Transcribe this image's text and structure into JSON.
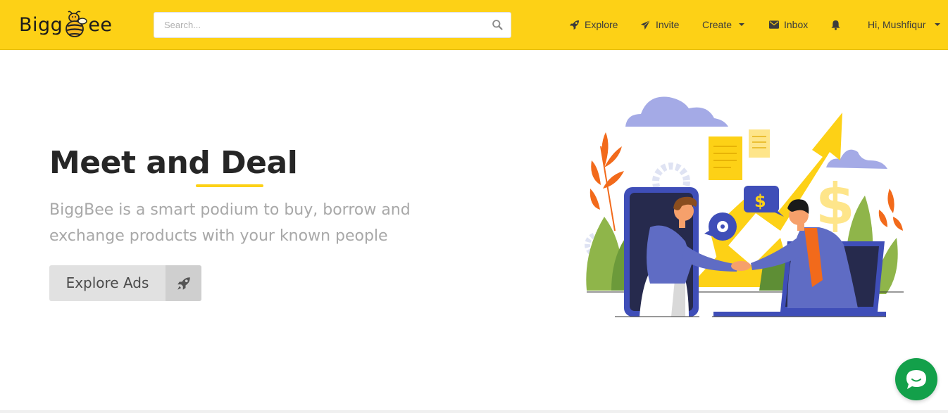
{
  "header": {
    "logo": {
      "text_left": "Bigg",
      "text_right": "ee",
      "icon": "bee-icon"
    },
    "search": {
      "placeholder": "Search...",
      "value": "",
      "icon": "search-icon"
    },
    "nav": [
      {
        "label": "Explore",
        "icon": "rocket-icon"
      },
      {
        "label": "Invite",
        "icon": "paper-plane-icon"
      },
      {
        "label": "Create",
        "icon": "caret-down-icon"
      },
      {
        "label": "Inbox",
        "icon": "envelope-icon"
      },
      {
        "label": "",
        "icon": "bell-icon"
      }
    ],
    "user_menu": {
      "label": "Hi, Mushfiqur",
      "icon": "caret-down-icon"
    }
  },
  "hero": {
    "title": "Meet and Deal",
    "subtitle": "BiggBee is a smart podium to buy, borrow and exchange products with your known people",
    "cta": {
      "label": "Explore Ads",
      "icon": "rocket-icon"
    },
    "illustration": "handshake-deal-illustration"
  },
  "chat": {
    "icon": "chat-bubble-icon"
  },
  "colors": {
    "brand_yellow": "#fdd116",
    "title_text": "#262626",
    "subtitle_text": "#a8a8a8",
    "chat_green": "#13a04a",
    "illustration_blue": "#3f4eb8",
    "illustration_orange": "#f26a1b"
  }
}
